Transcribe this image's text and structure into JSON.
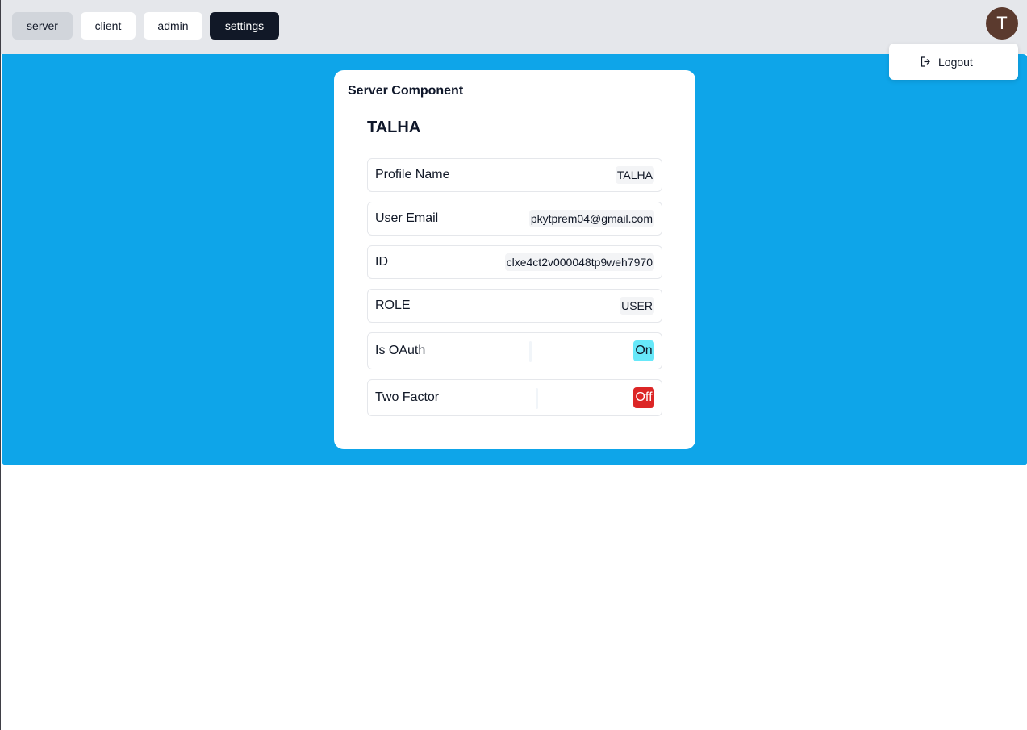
{
  "nav": {
    "server": "server",
    "client": "client",
    "admin": "admin",
    "settings": "settings"
  },
  "user_menu": {
    "avatar_initial": "T",
    "logout_label": "Logout",
    "logout_icon": "logout-icon"
  },
  "card": {
    "title": "Server Component",
    "user_name": "TALHA",
    "rows": [
      {
        "label": "Profile Name",
        "value": "TALHA"
      },
      {
        "label": "User Email",
        "value": "pkytprem04@gmail.com"
      },
      {
        "label": "ID",
        "value": "clxe4ct2v000048tp9weh7970"
      },
      {
        "label": "ROLE",
        "value": "USER"
      }
    ],
    "toggles": [
      {
        "label": "Is OAuth",
        "value": "On",
        "color": "#67e8f9"
      },
      {
        "label": "Two Factor",
        "value": "Off",
        "color": "#dc2626"
      }
    ]
  },
  "colors": {
    "main_background": "#0ea5e9",
    "topbar_background": "#e5e7eb",
    "active_nav": "#111827",
    "avatar": "#5b3a2e"
  }
}
